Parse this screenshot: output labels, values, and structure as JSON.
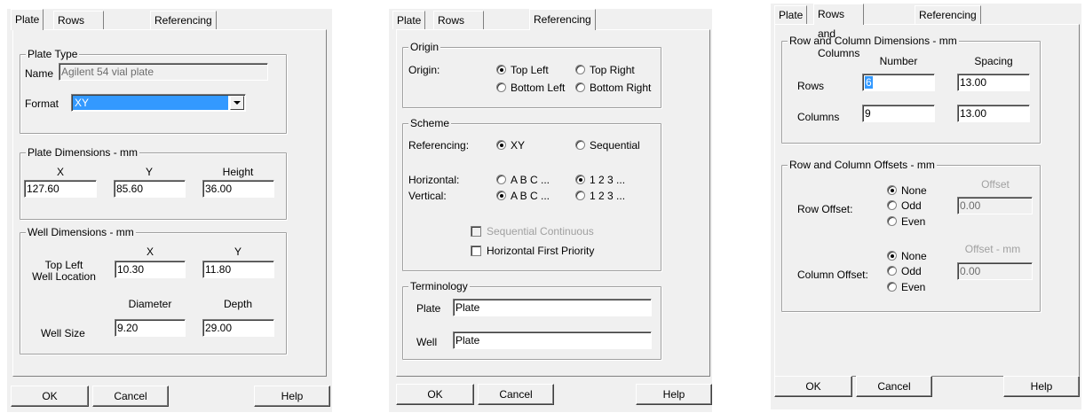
{
  "dialog1": {
    "tabs": [
      "Plate",
      "Rows and Columns",
      "Referencing"
    ],
    "plate_type": {
      "title": "Plate Type",
      "name_label": "Name",
      "name_value": "Agilent 54 vial plate",
      "format_label": "Format",
      "format_value": "XY"
    },
    "plate_dims": {
      "title": "Plate Dimensions - mm",
      "x_label": "X",
      "y_label": "Y",
      "height_label": "Height",
      "x_value": "127.60",
      "y_value": "85.60",
      "height_value": "36.00"
    },
    "well_dims": {
      "title": "Well Dimensions - mm",
      "x_label": "X",
      "y_label": "Y",
      "top_left_label": "Top Left",
      "well_location_label": "Well Location",
      "x_value": "10.30",
      "y_value": "11.80",
      "diameter_label": "Diameter",
      "depth_label": "Depth",
      "well_size_label": "Well Size",
      "diameter_value": "9.20",
      "depth_value": "29.00"
    },
    "buttons": {
      "ok": "OK",
      "cancel": "Cancel",
      "help": "Help"
    }
  },
  "dialog2": {
    "tabs": [
      "Plate",
      "Rows and Columns",
      "Referencing"
    ],
    "origin": {
      "title": "Origin",
      "label": "Origin:",
      "top_left": "Top Left",
      "top_right": "Top Right",
      "bottom_left": "Bottom Left",
      "bottom_right": "Bottom Right"
    },
    "scheme": {
      "title": "Scheme",
      "referencing_label": "Referencing:",
      "xy": "XY",
      "sequential": "Sequential",
      "horizontal_label": "Horizontal:",
      "vertical_label": "Vertical:",
      "abc": "A B C ...",
      "num": "1 2 3 ...",
      "seq_continuous": "Sequential Continuous",
      "horiz_first": "Horizontal First Priority"
    },
    "terminology": {
      "title": "Terminology",
      "plate_label": "Plate",
      "plate_value": "Plate",
      "well_label": "Well",
      "well_value": "Plate"
    },
    "buttons": {
      "ok": "OK",
      "cancel": "Cancel",
      "help": "Help"
    }
  },
  "dialog3": {
    "tabs": [
      "Plate",
      "Rows and Columns",
      "Referencing"
    ],
    "dims": {
      "title": "Row and Column Dimensions - mm",
      "number_label": "Number",
      "spacing_label": "Spacing",
      "rows_label": "Rows",
      "columns_label": "Columns",
      "rows_number": "6",
      "rows_spacing": "13.00",
      "columns_number": "9",
      "columns_spacing": "13.00"
    },
    "offsets": {
      "title": "Row and Column Offsets - mm",
      "none": "None",
      "odd": "Odd",
      "even": "Even",
      "row_offset_label": "Row Offset:",
      "column_offset_label": "Column Offset:",
      "offset_label": "Offset",
      "offset_mm_label": "Offset - mm",
      "row_offset_value": "0.00",
      "column_offset_value": "0.00"
    },
    "buttons": {
      "ok": "OK",
      "cancel": "Cancel",
      "help": "Help"
    }
  }
}
